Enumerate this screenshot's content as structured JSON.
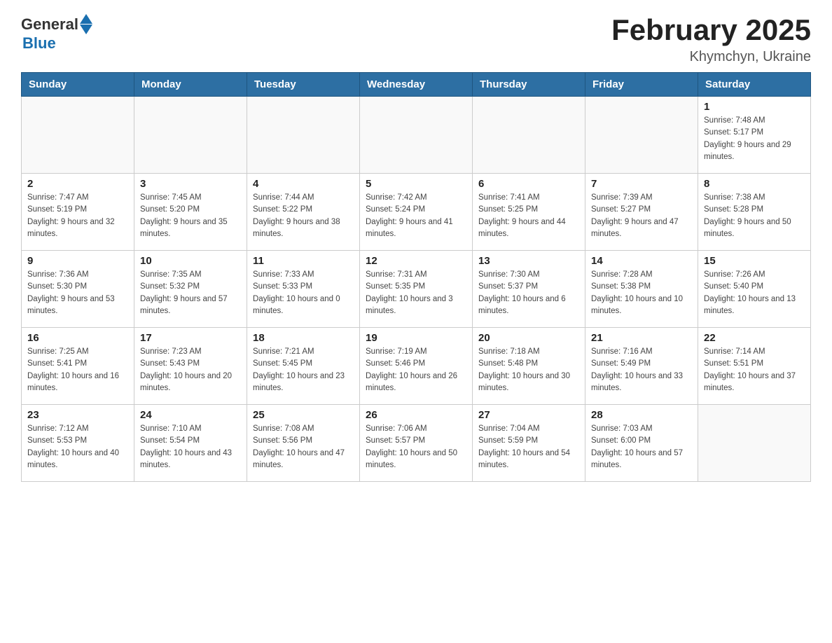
{
  "header": {
    "logo_general": "General",
    "logo_blue": "Blue",
    "title": "February 2025",
    "subtitle": "Khymchyn, Ukraine"
  },
  "weekdays": [
    "Sunday",
    "Monday",
    "Tuesday",
    "Wednesday",
    "Thursday",
    "Friday",
    "Saturday"
  ],
  "weeks": [
    [
      {
        "day": "",
        "sunrise": "",
        "sunset": "",
        "daylight": ""
      },
      {
        "day": "",
        "sunrise": "",
        "sunset": "",
        "daylight": ""
      },
      {
        "day": "",
        "sunrise": "",
        "sunset": "",
        "daylight": ""
      },
      {
        "day": "",
        "sunrise": "",
        "sunset": "",
        "daylight": ""
      },
      {
        "day": "",
        "sunrise": "",
        "sunset": "",
        "daylight": ""
      },
      {
        "day": "",
        "sunrise": "",
        "sunset": "",
        "daylight": ""
      },
      {
        "day": "1",
        "sunrise": "Sunrise: 7:48 AM",
        "sunset": "Sunset: 5:17 PM",
        "daylight": "Daylight: 9 hours and 29 minutes."
      }
    ],
    [
      {
        "day": "2",
        "sunrise": "Sunrise: 7:47 AM",
        "sunset": "Sunset: 5:19 PM",
        "daylight": "Daylight: 9 hours and 32 minutes."
      },
      {
        "day": "3",
        "sunrise": "Sunrise: 7:45 AM",
        "sunset": "Sunset: 5:20 PM",
        "daylight": "Daylight: 9 hours and 35 minutes."
      },
      {
        "day": "4",
        "sunrise": "Sunrise: 7:44 AM",
        "sunset": "Sunset: 5:22 PM",
        "daylight": "Daylight: 9 hours and 38 minutes."
      },
      {
        "day": "5",
        "sunrise": "Sunrise: 7:42 AM",
        "sunset": "Sunset: 5:24 PM",
        "daylight": "Daylight: 9 hours and 41 minutes."
      },
      {
        "day": "6",
        "sunrise": "Sunrise: 7:41 AM",
        "sunset": "Sunset: 5:25 PM",
        "daylight": "Daylight: 9 hours and 44 minutes."
      },
      {
        "day": "7",
        "sunrise": "Sunrise: 7:39 AM",
        "sunset": "Sunset: 5:27 PM",
        "daylight": "Daylight: 9 hours and 47 minutes."
      },
      {
        "day": "8",
        "sunrise": "Sunrise: 7:38 AM",
        "sunset": "Sunset: 5:28 PM",
        "daylight": "Daylight: 9 hours and 50 minutes."
      }
    ],
    [
      {
        "day": "9",
        "sunrise": "Sunrise: 7:36 AM",
        "sunset": "Sunset: 5:30 PM",
        "daylight": "Daylight: 9 hours and 53 minutes."
      },
      {
        "day": "10",
        "sunrise": "Sunrise: 7:35 AM",
        "sunset": "Sunset: 5:32 PM",
        "daylight": "Daylight: 9 hours and 57 minutes."
      },
      {
        "day": "11",
        "sunrise": "Sunrise: 7:33 AM",
        "sunset": "Sunset: 5:33 PM",
        "daylight": "Daylight: 10 hours and 0 minutes."
      },
      {
        "day": "12",
        "sunrise": "Sunrise: 7:31 AM",
        "sunset": "Sunset: 5:35 PM",
        "daylight": "Daylight: 10 hours and 3 minutes."
      },
      {
        "day": "13",
        "sunrise": "Sunrise: 7:30 AM",
        "sunset": "Sunset: 5:37 PM",
        "daylight": "Daylight: 10 hours and 6 minutes."
      },
      {
        "day": "14",
        "sunrise": "Sunrise: 7:28 AM",
        "sunset": "Sunset: 5:38 PM",
        "daylight": "Daylight: 10 hours and 10 minutes."
      },
      {
        "day": "15",
        "sunrise": "Sunrise: 7:26 AM",
        "sunset": "Sunset: 5:40 PM",
        "daylight": "Daylight: 10 hours and 13 minutes."
      }
    ],
    [
      {
        "day": "16",
        "sunrise": "Sunrise: 7:25 AM",
        "sunset": "Sunset: 5:41 PM",
        "daylight": "Daylight: 10 hours and 16 minutes."
      },
      {
        "day": "17",
        "sunrise": "Sunrise: 7:23 AM",
        "sunset": "Sunset: 5:43 PM",
        "daylight": "Daylight: 10 hours and 20 minutes."
      },
      {
        "day": "18",
        "sunrise": "Sunrise: 7:21 AM",
        "sunset": "Sunset: 5:45 PM",
        "daylight": "Daylight: 10 hours and 23 minutes."
      },
      {
        "day": "19",
        "sunrise": "Sunrise: 7:19 AM",
        "sunset": "Sunset: 5:46 PM",
        "daylight": "Daylight: 10 hours and 26 minutes."
      },
      {
        "day": "20",
        "sunrise": "Sunrise: 7:18 AM",
        "sunset": "Sunset: 5:48 PM",
        "daylight": "Daylight: 10 hours and 30 minutes."
      },
      {
        "day": "21",
        "sunrise": "Sunrise: 7:16 AM",
        "sunset": "Sunset: 5:49 PM",
        "daylight": "Daylight: 10 hours and 33 minutes."
      },
      {
        "day": "22",
        "sunrise": "Sunrise: 7:14 AM",
        "sunset": "Sunset: 5:51 PM",
        "daylight": "Daylight: 10 hours and 37 minutes."
      }
    ],
    [
      {
        "day": "23",
        "sunrise": "Sunrise: 7:12 AM",
        "sunset": "Sunset: 5:53 PM",
        "daylight": "Daylight: 10 hours and 40 minutes."
      },
      {
        "day": "24",
        "sunrise": "Sunrise: 7:10 AM",
        "sunset": "Sunset: 5:54 PM",
        "daylight": "Daylight: 10 hours and 43 minutes."
      },
      {
        "day": "25",
        "sunrise": "Sunrise: 7:08 AM",
        "sunset": "Sunset: 5:56 PM",
        "daylight": "Daylight: 10 hours and 47 minutes."
      },
      {
        "day": "26",
        "sunrise": "Sunrise: 7:06 AM",
        "sunset": "Sunset: 5:57 PM",
        "daylight": "Daylight: 10 hours and 50 minutes."
      },
      {
        "day": "27",
        "sunrise": "Sunrise: 7:04 AM",
        "sunset": "Sunset: 5:59 PM",
        "daylight": "Daylight: 10 hours and 54 minutes."
      },
      {
        "day": "28",
        "sunrise": "Sunrise: 7:03 AM",
        "sunset": "Sunset: 6:00 PM",
        "daylight": "Daylight: 10 hours and 57 minutes."
      },
      {
        "day": "",
        "sunrise": "",
        "sunset": "",
        "daylight": ""
      }
    ]
  ]
}
